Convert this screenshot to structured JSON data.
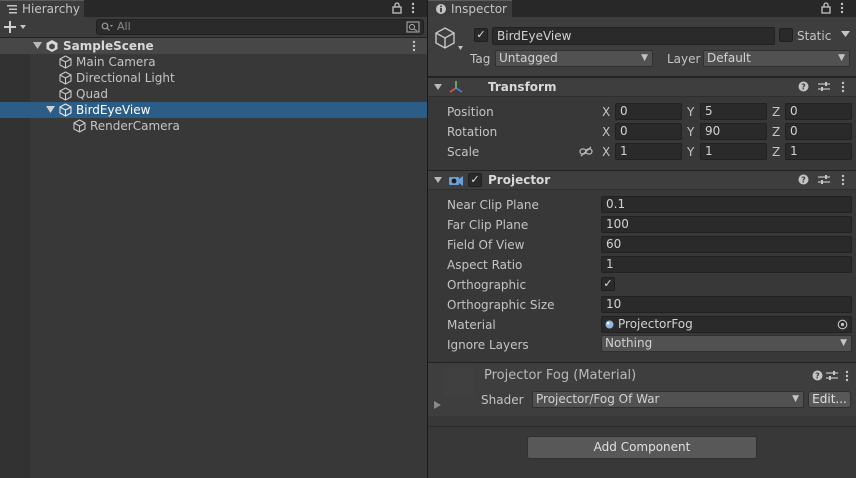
{
  "hierarchy": {
    "tab_label": "Hierarchy",
    "search_placeholder": "All",
    "scene_name": "SampleScene",
    "items": [
      {
        "label": "Main Camera"
      },
      {
        "label": "Directional Light"
      },
      {
        "label": "Quad"
      },
      {
        "label": "BirdEyeView"
      },
      {
        "label": "RenderCamera"
      }
    ]
  },
  "inspector": {
    "tab_label": "Inspector",
    "object_name": "BirdEyeView",
    "static_label": "Static",
    "tag_label": "Tag",
    "tag_value": "Untagged",
    "layer_label": "Layer",
    "layer_value": "Default",
    "transform": {
      "title": "Transform",
      "rows": [
        {
          "label": "Position",
          "x": "0",
          "y": "5",
          "z": "0"
        },
        {
          "label": "Rotation",
          "x": "0",
          "y": "90",
          "z": "0"
        },
        {
          "label": "Scale",
          "x": "1",
          "y": "1",
          "z": "1"
        }
      ],
      "axis_x": "X",
      "axis_y": "Y",
      "axis_z": "Z"
    },
    "projector": {
      "title": "Projector",
      "near_clip_label": "Near Clip Plane",
      "near_clip_value": "0.1",
      "far_clip_label": "Far Clip Plane",
      "far_clip_value": "100",
      "fov_label": "Field Of View",
      "fov_value": "60",
      "aspect_label": "Aspect Ratio",
      "aspect_value": "1",
      "ortho_label": "Orthographic",
      "ortho_checked": true,
      "ortho_size_label": "Orthographic Size",
      "ortho_size_value": "10",
      "material_label": "Material",
      "material_value": "ProjectorFog",
      "ignore_layers_label": "Ignore Layers",
      "ignore_layers_value": "Nothing"
    },
    "material": {
      "title": "Projector Fog (Material)",
      "shader_label": "Shader",
      "shader_value": "Projector/Fog Of War",
      "edit_label": "Edit..."
    },
    "add_component_label": "Add Component"
  },
  "colors": {
    "selection": "#2c5d87",
    "panel_bg": "#383838",
    "field_bg": "#2a2a2a"
  }
}
